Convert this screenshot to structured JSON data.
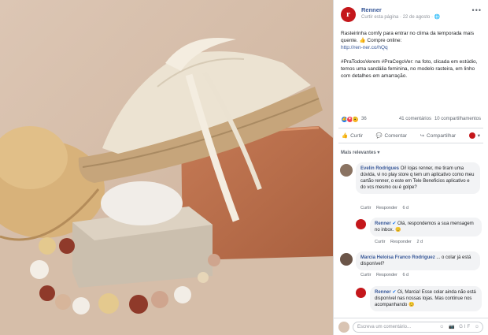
{
  "post": {
    "page_name": "Renner",
    "meta": "Curtir esta página · 22 de agosto · 🌐",
    "logo_letter": "r",
    "text1": "Rasteirinha comfy para entrar no clima da temporada mais quente. 👍 Compre online:",
    "link": "http://ren-ner.co/hQq",
    "text2": "#PraTodosVerem #PraCegoVer: na foto, clicada em estúdio, temos uma sandália feminina, no modelo rasteira, em linho com detalhes em amarração.",
    "reaction_count": "36",
    "comments_count": "41 comentários",
    "shares_count": "10 compartilhamentos",
    "actions": {
      "like": "Curtir",
      "comment": "Comentar",
      "share": "Compartilhar"
    },
    "sort_label": "Mais relevantes ▾"
  },
  "comments": [
    {
      "author": "Evelin Rodrigues",
      "text": "Oi! lojas renner, me tiram uma dúvida, vi no play store q tem um aplicativo como meu cartão renner, o este em Tele Beneficios aplicativo e do vcs mesmo ou é golpe?",
      "like": "Curtir",
      "reply": "Responder",
      "time": "6 d"
    },
    {
      "author": "Renner",
      "text": "Olá, respondemos a sua mensagem no inbox. 😊",
      "like": "Curtir",
      "reply": "Responder",
      "time": "2 d"
    },
    {
      "author": "Marcia Heloisa Franco Rodriguez",
      "text": "... o colar já está disponível?",
      "like": "Curtir",
      "reply": "Responder",
      "time": "6 d"
    },
    {
      "author": "Renner",
      "text": "Oi, Marcia! Esse colar ainda não está disponível nas nossas lojas. Mas continue nos acompanhando 😊",
      "like": "",
      "reply": "",
      "time": ""
    }
  ],
  "composer": {
    "placeholder": "Escreva um comentário...",
    "icons": "☺ 📷 GIF ☺"
  },
  "colors": {
    "brand": "#c4171b",
    "link": "#385898"
  }
}
